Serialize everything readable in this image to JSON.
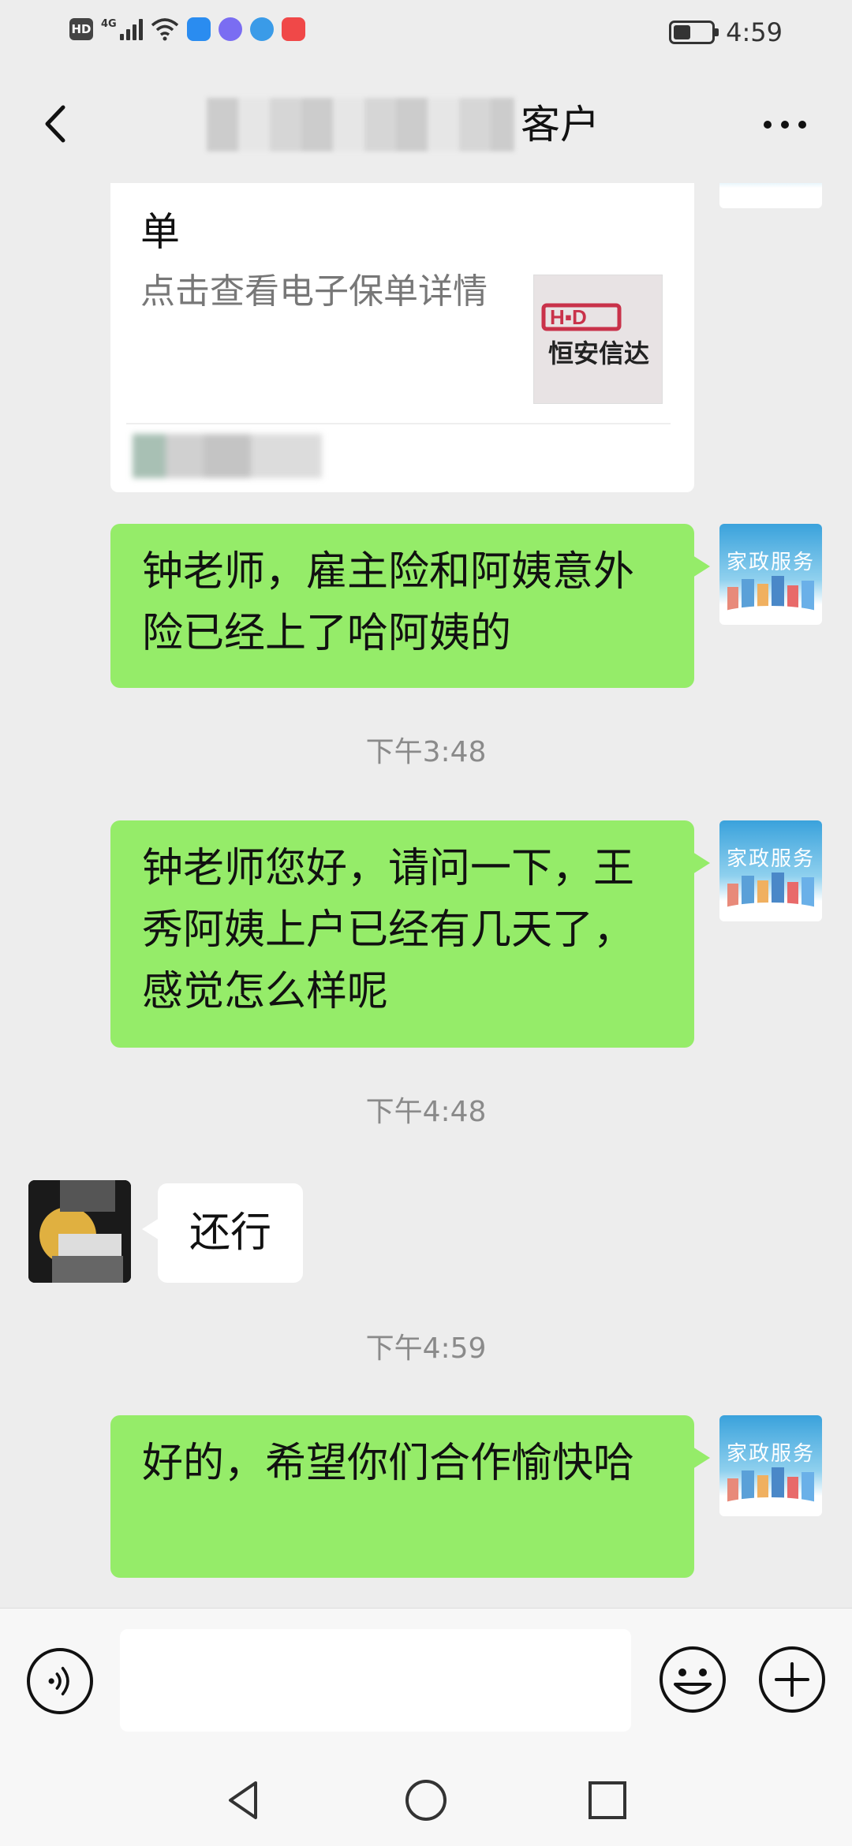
{
  "status_bar": {
    "network": "4G",
    "hd": "HD",
    "time": "4:59",
    "battery_level": 0.45
  },
  "header": {
    "title_suffix": "客户"
  },
  "card": {
    "title": "单",
    "description": "点击查看电子保单详情",
    "thumb_logo": "H▪D",
    "thumb_text": "恒安信达"
  },
  "messages": [
    {
      "type": "outgoing",
      "text": "钟老师，雇主险和阿姨意外险已经上了哈阿姨的"
    },
    {
      "type": "time",
      "text": "下午3:48"
    },
    {
      "type": "outgoing",
      "text": "钟老师您好，请问一下，王秀阿姨上户已经有几天了，感觉怎么样呢"
    },
    {
      "type": "time",
      "text": "下午4:48"
    },
    {
      "type": "incoming",
      "text": "还行"
    },
    {
      "type": "time",
      "text": "下午4:59"
    },
    {
      "type": "outgoing",
      "text": "好的，希望你们合作愉快哈"
    }
  ],
  "my_avatar": {
    "text": "家政服务"
  },
  "input": {
    "value": "",
    "placeholder": ""
  },
  "colors": {
    "background": "#ededed",
    "outgoing_bubble": "#95ec69",
    "incoming_bubble": "#ffffff",
    "timestamp": "#8a8a8a"
  }
}
